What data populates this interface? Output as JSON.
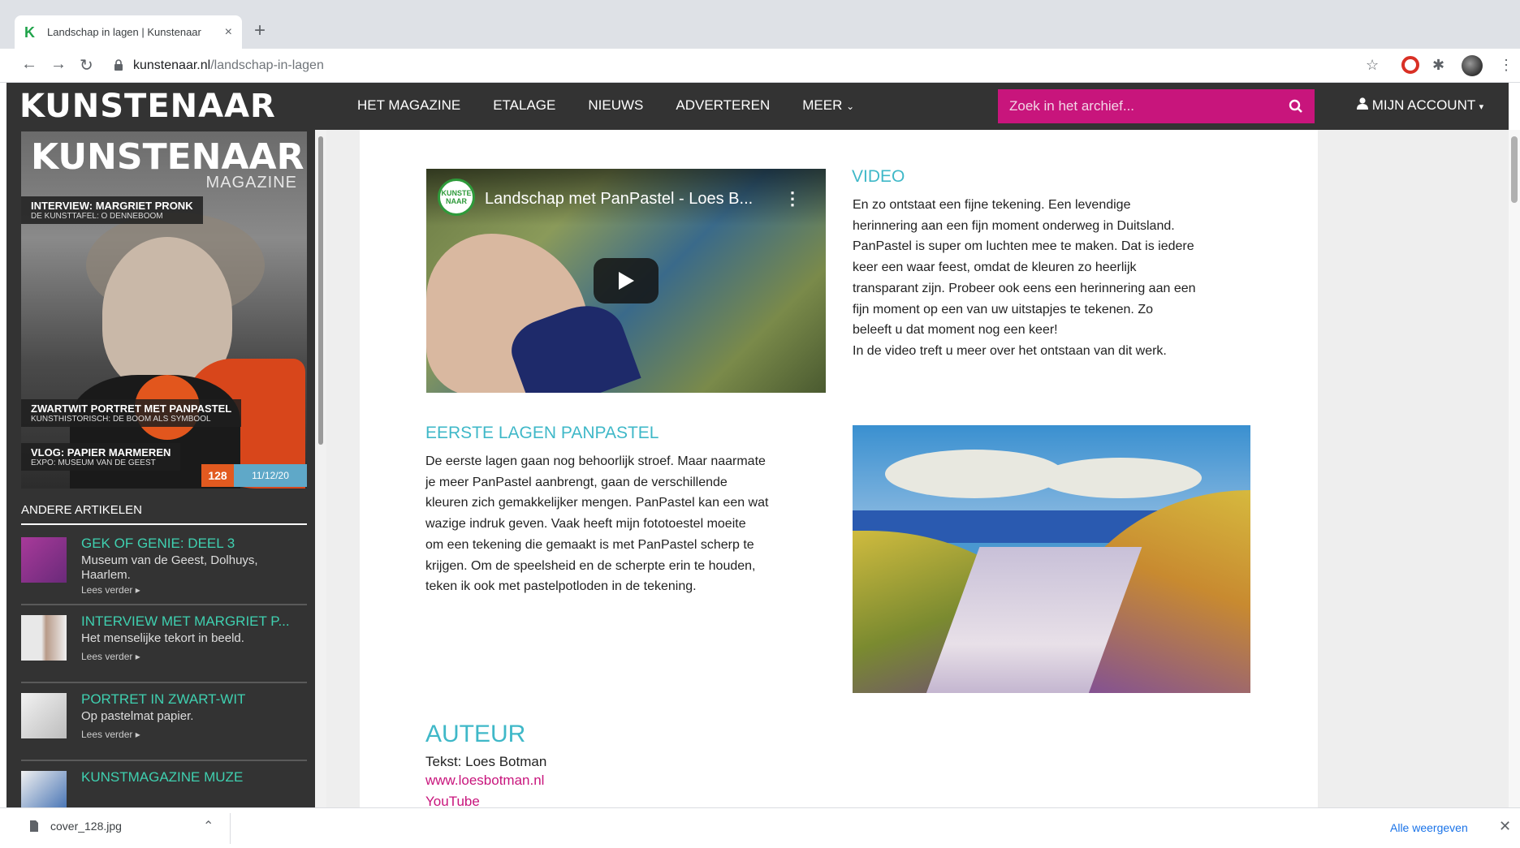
{
  "browser": {
    "tab_title": "Landschap in lagen | Kunstenaar",
    "new_tab": "+",
    "tab_close": "×",
    "url_host": "kunstenaar.nl",
    "url_path": "/landschap-in-lagen"
  },
  "site": {
    "logo": "KUNSTENAAR",
    "nav": [
      "HET MAGAZINE",
      "ETALAGE",
      "NIEUWS",
      "ADVERTEREN",
      "MEER"
    ],
    "search_placeholder": "Zoek in het archief...",
    "account": "MIJN ACCOUNT"
  },
  "sidebar": {
    "cover": {
      "title": "KUNSTENAAR",
      "subtitle": "MAGAZINE",
      "lines": [
        {
          "l1": "INTERVIEW: MARGRIET PRONK",
          "l2": "DE KUNSTTAFEL: O DENNEBOOM"
        },
        {
          "l1": "ZWARTWIT PORTRET MET PANPASTEL",
          "l2": "KUNSTHISTORISCH: DE BOOM ALS SYMBOOL"
        },
        {
          "l1": "VLOG: PAPIER MARMEREN",
          "l2": "EXPO: MUSEUM VAN DE GEEST"
        }
      ],
      "issue": "128",
      "date": "11/12/20"
    },
    "heading": "ANDERE ARTIKELEN",
    "articles": [
      {
        "title": "GEK OF GENIE: DEEL 3",
        "desc": "Museum van de Geest, Dolhuys, Haarlem.",
        "more": "Lees verder ▸"
      },
      {
        "title": "INTERVIEW MET MARGRIET P...",
        "desc": "Het menselijke tekort in beeld.",
        "more": "Lees verder ▸"
      },
      {
        "title": "PORTRET IN ZWART-WIT",
        "desc": "Op pastelmat papier.",
        "more": "Lees verder ▸"
      },
      {
        "title": "KUNSTMAGAZINE MUZE",
        "desc": "",
        "more": ""
      }
    ]
  },
  "content": {
    "clipped_top": "Vaak heeft mijn fototoestel moeite...",
    "video": {
      "channel_logo": "KUNSTE NAAR",
      "title": "Landschap met PanPastel - Loes B..."
    },
    "video_heading": "VIDEO",
    "video_text": [
      "En zo ontstaat een fijne tekening. Een levendige",
      "herinnering aan een fijn moment onderweg in Duitsland.",
      "PanPastel is super om luchten mee te maken. Dat is iedere",
      "keer een waar feest, omdat de kleuren zo heerlijk",
      "transparant zijn. Probeer ook eens een herinnering aan een",
      "fijn moment op een van uw uitstapjes te tekenen. Zo",
      "beleeft u dat moment nog een keer!",
      "In de video treft u meer over het ontstaan van dit werk."
    ],
    "layers_heading": "EERSTE LAGEN PANPASTEL",
    "layers_text": [
      "De eerste lagen gaan nog behoorlijk stroef. Maar naarmate",
      "je meer PanPastel aanbrengt, gaan de verschillende",
      "kleuren zich gemakkelijker mengen. PanPastel kan een wat",
      "wazige indruk geven. Vaak heeft mijn fototoestel moeite",
      "om een tekening die gemaakt is met PanPastel scherp te",
      "krijgen. Om de speelsheid en de scherpte erin te houden,",
      "teken ik ook met pastelpotloden in de tekening."
    ],
    "author_heading": "AUTEUR",
    "author_text": "Tekst: Loes Botman",
    "author_link": "www.loesbotman.nl",
    "youtube_link": "YouTube"
  },
  "downloads": {
    "file": "cover_128.jpg",
    "show_all": "Alle weergeven"
  },
  "colors": {
    "accent_magenta": "#c8157c",
    "accent_teal": "#3fb8c8",
    "header_dark": "#333333"
  }
}
